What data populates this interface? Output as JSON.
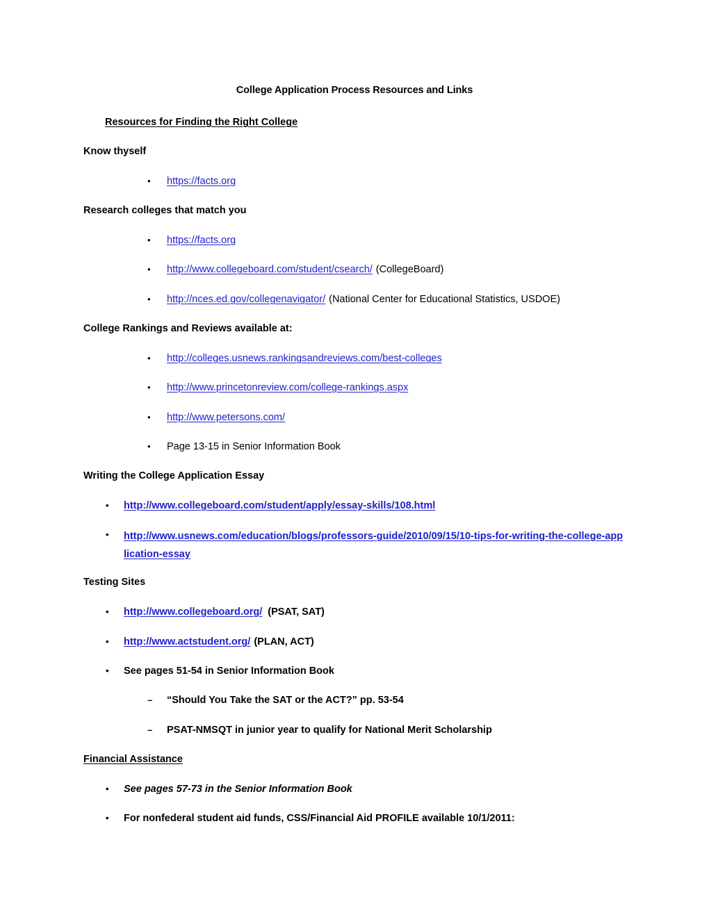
{
  "document": {
    "title": "College Application Process Resources and Links",
    "link_color": "#2020CE",
    "text_color": "#000000",
    "bullet_glyph": "•",
    "dash_glyph": "–"
  },
  "sections": {
    "resources": {
      "heading": "Resources for Finding the Right College",
      "know_thyself": {
        "label": "Know thyself",
        "items": [
          {
            "link": "https://facts.org",
            "note": ""
          }
        ]
      },
      "research": {
        "label": "Research colleges that match you",
        "items": [
          {
            "link": "https://facts.org",
            "note": ""
          },
          {
            "link": "http://www.collegeboard.com/student/csearch/",
            "note": "(CollegeBoard)"
          },
          {
            "link": "http://nces.ed.gov/collegenavigator/",
            "note": "(National Center for Educational Statistics, USDOE)"
          }
        ]
      },
      "rankings": {
        "label": "College Rankings and Reviews available at:",
        "items": [
          {
            "link": "http://colleges.usnews.rankingsandreviews.com/best-colleges",
            "note": ""
          },
          {
            "link": "http://www.princetonreview.com/college-rankings.aspx",
            "note": ""
          },
          {
            "link": "http://www.petersons.com/",
            "note": ""
          }
        ],
        "text_item": "Page 13-15 in Senior Information Book"
      }
    },
    "essay": {
      "label": "Writing the College Application Essay",
      "items": [
        {
          "link": "http://www.collegeboard.com/student/apply/essay-skills/108.html",
          "note": ""
        },
        {
          "link": "http://www.usnews.com/education/blogs/professors-guide/2010/09/15/10-tips-for-writing-the-college-application-essay",
          "note": ""
        }
      ]
    },
    "testing": {
      "label": "Testing Sites",
      "items": [
        {
          "link": "http://www.collegeboard.org/",
          "note": "(PSAT, SAT)"
        },
        {
          "link": "http://www.actstudent.org/",
          "note": "(PLAN, ACT)"
        }
      ],
      "text_item": "See pages 51-54 in Senior Information Book",
      "subitems": [
        "“Should You Take the SAT or the ACT?” pp. 53-54",
        "PSAT-NMSQT in junior year to qualify for National Merit Scholarship"
      ]
    },
    "financial": {
      "heading": "Financial Assistance",
      "items": [
        "See pages 57-73 in the Senior Information Book",
        "For nonfederal student aid funds, CSS/Financial Aid PROFILE  available 10/1/2011:"
      ]
    }
  }
}
